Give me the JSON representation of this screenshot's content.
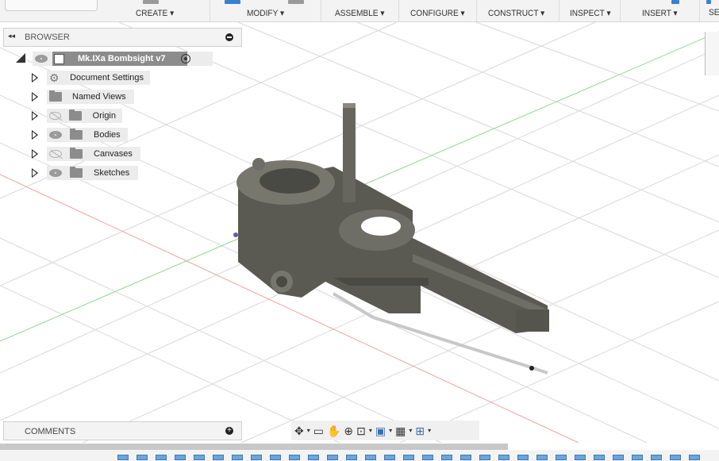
{
  "toolbar": {
    "groups": [
      {
        "label": "CREATE ▾"
      },
      {
        "label": "MODIFY ▾"
      },
      {
        "label": "ASSEMBLE ▾"
      },
      {
        "label": "CONFIGURE ▾"
      },
      {
        "label": "CONSTRUCT ▾"
      },
      {
        "label": "INSPECT ▾"
      },
      {
        "label": "INSERT ▾"
      },
      {
        "label": "SE"
      }
    ]
  },
  "browser": {
    "title": "BROWSER",
    "root": "Mk.IXa Bombsight v7",
    "items": [
      {
        "label": "Document Settings",
        "icon": "gear-icon"
      },
      {
        "label": "Named Views",
        "icon": "folder-icon"
      },
      {
        "label": "Origin",
        "icon": "folder-icon",
        "visible": false
      },
      {
        "label": "Bodies",
        "icon": "folder-icon",
        "visible": true
      },
      {
        "label": "Canvases",
        "icon": "folder-icon",
        "visible": false
      },
      {
        "label": "Sketches",
        "icon": "folder-icon",
        "visible": true
      }
    ]
  },
  "comments": {
    "title": "COMMENTS"
  },
  "navbar": {
    "icons": [
      "orbit-icon",
      "look-at-icon",
      "pan-icon",
      "zoom-icon",
      "fit-icon",
      "display-settings-icon",
      "grid-icon",
      "viewports-icon"
    ]
  }
}
